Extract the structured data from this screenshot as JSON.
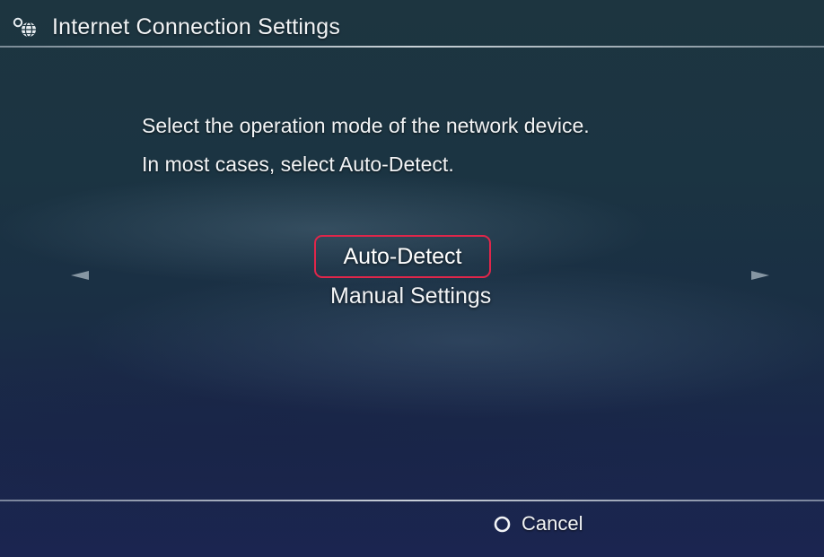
{
  "header": {
    "icon": "network-settings-icon",
    "title": "Internet Connection Settings"
  },
  "instructions": {
    "line1": "Select the operation mode of the network device.",
    "line2": "In most cases, select Auto-Detect."
  },
  "options": {
    "items": [
      {
        "label": "Auto-Detect",
        "selected": true
      },
      {
        "label": "Manual Settings",
        "selected": false
      }
    ],
    "highlight_color": "#e0264a"
  },
  "navigation": {
    "left_icon": "left-arrow-icon",
    "right_icon": "right-arrow-icon"
  },
  "footer": {
    "cancel_icon": "circle-button-icon",
    "cancel_label": "Cancel"
  }
}
